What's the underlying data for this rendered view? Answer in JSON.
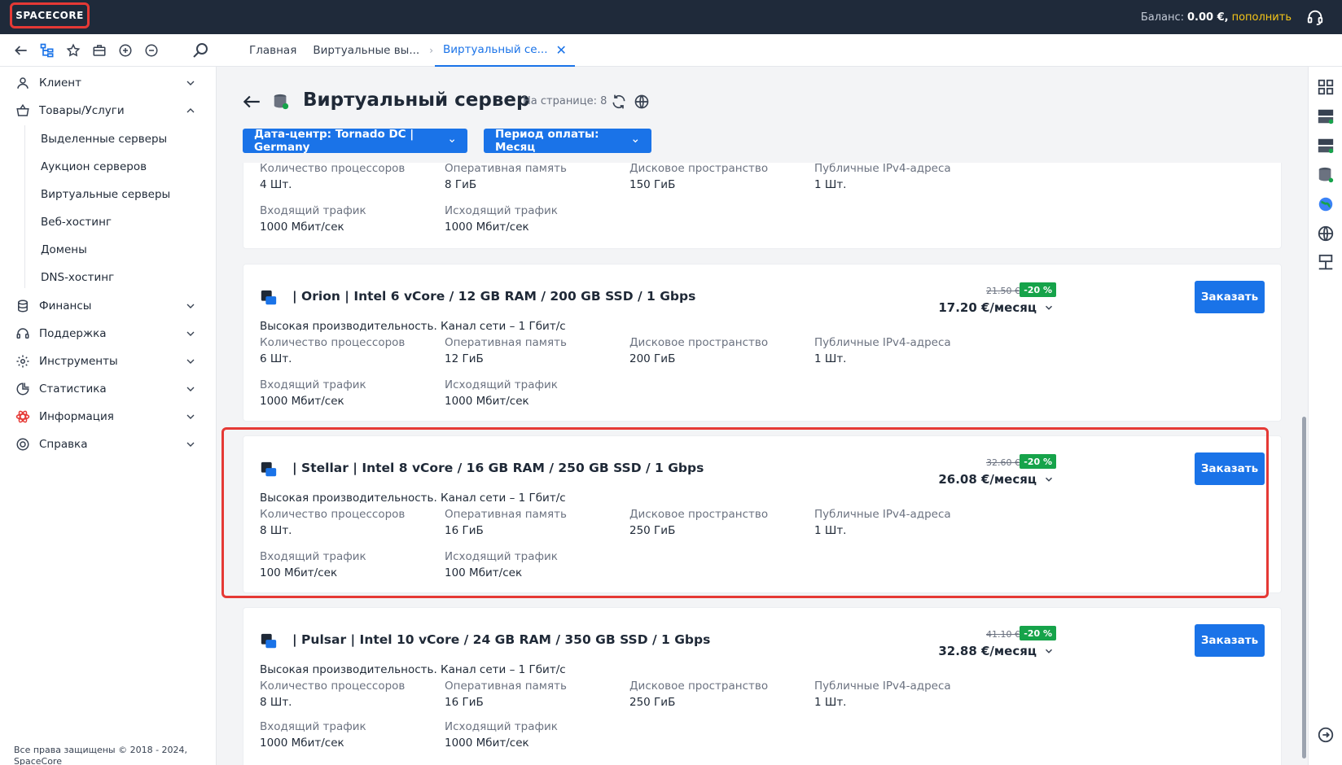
{
  "brand": {
    "logo": "SPACECORE"
  },
  "header": {
    "balance_label": "Баланс:",
    "balance_value": "0.00 €,",
    "topup": "пополнить"
  },
  "tabs": [
    {
      "label": "Главная"
    },
    {
      "label": "Виртуальные вы..."
    },
    {
      "label": "Виртуальный се..."
    }
  ],
  "sidebar": {
    "client": "Клиент",
    "goods": "Товары/Услуги",
    "sub": [
      "Выделенные серверы",
      "Аукцион серверов",
      "Виртуальные серверы",
      "Веб-хостинг",
      "Домены",
      "DNS-хостинг"
    ],
    "finance": "Финансы",
    "support": "Поддержка",
    "tools": "Инструменты",
    "stats": "Статистика",
    "info": "Информация",
    "help": "Справка",
    "copyright": "Все права защищены © 2018 - 2024, SpaceCore"
  },
  "page": {
    "title": "Виртуальный сервер",
    "per_page": "На странице: 8",
    "filter_dc": "Дата-центр: Tornado DC | Germany",
    "filter_period": "Период оплаты: Месяц"
  },
  "labels": {
    "cpu": "Количество процессоров",
    "ram": "Оперативная память",
    "disk": "Дисковое пространство",
    "ipv4": "Публичные IPv4-адреса",
    "in": "Входящий трафик",
    "out": "Исходящий трафик",
    "order": "Заказать",
    "desc": "Высокая производительность. Канал сети – 1 Гбит/с"
  },
  "cards": [
    {
      "cpu": "4 Шт.",
      "ram": "8 ГиБ",
      "disk": "150 ГиБ",
      "ipv4": "1 Шт.",
      "in": "1000 Мбит/сек",
      "out": "1000 Мбит/сек"
    },
    {
      "name": "| Orion | Intel 6 vCore / 12 GB RAM / 200 GB SSD / 1 Gbps",
      "old": "21.50 €",
      "disc": "-20 %",
      "price": "17.20 €/месяц",
      "cpu": "6 Шт.",
      "ram": "12 ГиБ",
      "disk": "200 ГиБ",
      "ipv4": "1 Шт.",
      "in": "1000 Мбит/сек",
      "out": "1000 Мбит/сек"
    },
    {
      "name": "| Stellar | Intel 8 vCore / 16 GB RAM / 250 GB SSD / 1 Gbps",
      "old": "32.60 €",
      "disc": "-20 %",
      "price": "26.08 €/месяц",
      "cpu": "8 Шт.",
      "ram": "16 ГиБ",
      "disk": "250 ГиБ",
      "ipv4": "1 Шт.",
      "in": "100 Мбит/сек",
      "out": "100 Мбит/сек"
    },
    {
      "name": "| Pulsar | Intel 10 vCore / 24 GB RAM / 350 GB SSD / 1 Gbps",
      "old": "41.10 €",
      "disc": "-20 %",
      "price": "32.88 €/месяц",
      "cpu": "8 Шт.",
      "ram": "16 ГиБ",
      "disk": "250 ГиБ",
      "ipv4": "1 Шт.",
      "in": "1000 Мбит/сек",
      "out": "1000 Мбит/сек"
    }
  ]
}
